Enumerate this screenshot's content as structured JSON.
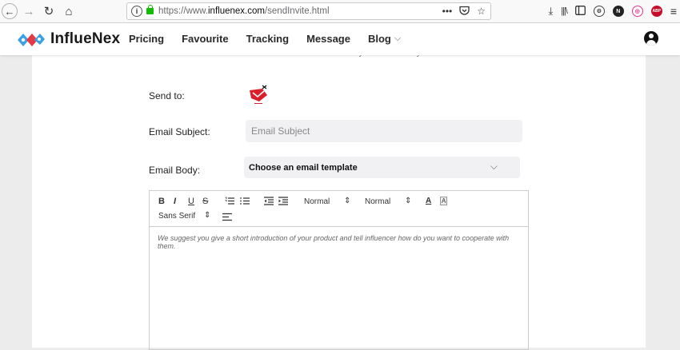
{
  "browser": {
    "url_prefix": "https://www.",
    "url_domain": "influenex.com",
    "url_path": "/sendInvite.html",
    "more_icon": "•••",
    "ext_abp": "ABP"
  },
  "header": {
    "logo_text": "InflueNex",
    "menu": [
      "Pricing",
      "Favourite",
      "Tracking",
      "Message",
      "Blog"
    ]
  },
  "form": {
    "notice": "This email will be sent to influencer's mailbox directly. Please check your inbox for future communication.",
    "send_to_label": "Send to:",
    "subject_label": "Email Subject:",
    "subject_placeholder": "Email Subject",
    "body_label": "Email Body:",
    "template_select": "Choose an email template"
  },
  "editor": {
    "bold": "B",
    "italic": "I",
    "underline": "U",
    "strike": "S",
    "heading": "Normal",
    "size": "Normal",
    "font": "Sans Serif",
    "placeholder": "We suggest you give a short introduction of your product and tell influencer how do you want to cooperate with them."
  },
  "colors": {
    "accent_blue": "#3aa0e8",
    "accent_red": "#e53945",
    "lock_green": "#12bc00"
  }
}
